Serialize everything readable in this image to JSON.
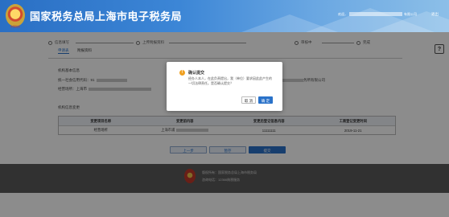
{
  "header": {
    "title": "国家税务总局上海市电子税务局",
    "emblem_label": "中国税务",
    "user_greeting": "欢迎，",
    "company_suffix": "有限公司",
    "logout": "退出"
  },
  "steps": [
    "信息填写",
    "上传附报资料",
    "审核中",
    "完成"
  ],
  "subtabs": [
    "申请表",
    "附报资料"
  ],
  "help_label": "?",
  "basic_section": {
    "title": "机构基本信息",
    "credit_code_label": "统一社会信用代码：",
    "credit_code_visible": "91",
    "tax_agency_label": "税务师事务所名称：",
    "tax_agency_visible": "上",
    "tax_agency_suffix": "务所有限公司",
    "address_label": "经营场所：",
    "address_visible": "上海市"
  },
  "change_section": {
    "title": "机构信息变更"
  },
  "table": {
    "headers": [
      "变更项目名称",
      "变更前内容",
      "变更后登记信息内容",
      "工商登记变更时间"
    ],
    "rows": [
      [
        "经营场所",
        "上海市浦",
        "11111111",
        "2019-11-21"
      ]
    ]
  },
  "buttons": {
    "prev": "上一步",
    "save": "暂存",
    "submit": "提交"
  },
  "footer": {
    "host_label": "版权所有：国家税务总局上海市税务局",
    "phone_label": "咨询电话：12366纳税服务"
  },
  "modal": {
    "icon": "!",
    "title": "确认提交",
    "text": "经办人本人，在此负责提出，我（单位）要求因此此产生的一切法律责任。是否确认提交？",
    "cancel": "取 消",
    "ok": "确 定"
  },
  "colors": {
    "header_blue": "#2a6fc4",
    "primary_blue": "#2a72c9",
    "warning_orange": "#f0a020",
    "footer_gray": "#5a5a5a"
  }
}
